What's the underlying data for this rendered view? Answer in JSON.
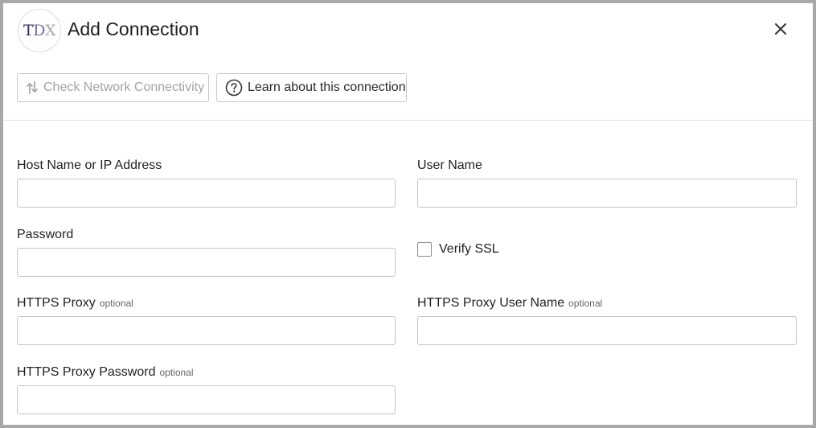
{
  "dialog": {
    "title": "Add Connection",
    "logo": {
      "t": "T",
      "d": "D",
      "x": "X"
    },
    "close_icon": "close-icon"
  },
  "toolbar": {
    "check_network_label": "Check Network Connectivity",
    "check_network_icon": "network-check-icon",
    "check_network_enabled": false,
    "learn_label": "Learn about this connection",
    "learn_icon": "help-circle-icon"
  },
  "form": {
    "host": {
      "label": "Host Name or IP Address",
      "value": "",
      "placeholder": ""
    },
    "username": {
      "label": "User Name",
      "value": "",
      "placeholder": ""
    },
    "password": {
      "label": "Password",
      "value": "",
      "placeholder": ""
    },
    "verify_ssl": {
      "label": "Verify SSL",
      "checked": false
    },
    "https_proxy": {
      "label": "HTTPS Proxy",
      "optional": "optional",
      "value": "",
      "placeholder": ""
    },
    "https_proxy_user": {
      "label": "HTTPS Proxy User Name",
      "optional": "optional",
      "value": "",
      "placeholder": ""
    },
    "https_proxy_password": {
      "label": "HTTPS Proxy Password",
      "optional": "optional",
      "value": "",
      "placeholder": ""
    }
  },
  "colors": {
    "frame_border": "#a9a9a9",
    "logo_dark": "#2e2a6b",
    "logo_mid": "#6a72a8",
    "logo_light": "#a9a9a9",
    "disabled_text": "#a3a3a3"
  }
}
